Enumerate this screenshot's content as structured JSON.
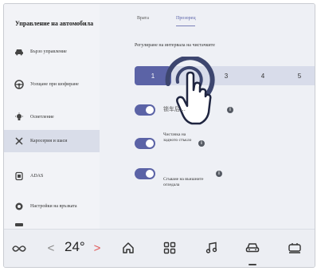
{
  "sidebar": {
    "title": "Управление на автомобила",
    "items": [
      {
        "label": "Бързо управление",
        "icon": "car-icon"
      },
      {
        "label": "Усещане при шофиране",
        "icon": "steering-wheel-icon"
      },
      {
        "label": "Осветление",
        "icon": "light-bulb-icon"
      },
      {
        "label": "Каросерия и шаси",
        "icon": "body-chassis-icon"
      },
      {
        "label": "ADAS",
        "icon": "adas-icon"
      },
      {
        "label": "Настройки на връзката",
        "icon": "connection-icon"
      },
      {
        "label": "",
        "icon": "more-icon"
      }
    ],
    "active_index": 3
  },
  "tabs": [
    {
      "label": "Врата"
    },
    {
      "label": "Прозорец"
    }
  ],
  "active_tab": 1,
  "wiper_interval": {
    "label": "Регулиране на интервала на чистачките",
    "options": [
      "1",
      "2",
      "3",
      "4",
      "5"
    ],
    "selected": "1"
  },
  "toggles": [
    {
      "label": "锁车后…",
      "on": true
    },
    {
      "label": "Чистачка на задното стъкло",
      "on": true
    },
    {
      "label": "Сгъване на външните огледала",
      "on": true
    }
  ],
  "bottom_bar": {
    "temperature": "24°",
    "temp_down": "<",
    "temp_up": ">",
    "icons": [
      "fan-icon",
      "home-icon",
      "apps-grid-icon",
      "music-icon",
      "car-icon",
      "seat-heater-icon"
    ],
    "active_icon": "car-icon"
  },
  "colors": {
    "accent": "#5b63a6",
    "active_tab": "#5961a8",
    "temp_arrow_active": "#e05a5a",
    "temp_arrow_inactive": "#888888",
    "sidebar_active_bg": "#d9dde9",
    "background": "#eef0f5"
  }
}
